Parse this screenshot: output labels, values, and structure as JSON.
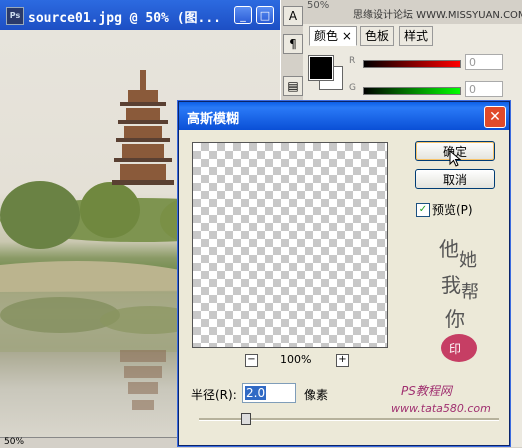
{
  "document": {
    "title": "source01.jpg @ 50% (图...",
    "app_icon": "Ps",
    "zoom_status": "50%",
    "buttons": [
      "_",
      "□"
    ]
  },
  "tools": {
    "items": [
      "A",
      "¶",
      "▤"
    ]
  },
  "color_panel": {
    "zoom_readout": "50%",
    "watermark": "思缘设计论坛 WWW.MISSYUAN.COM",
    "tabs": [
      "颜色",
      "色板",
      "样式"
    ],
    "tab_close": "×",
    "slider_labels": [
      "R",
      "G"
    ],
    "values": [
      "0",
      "0"
    ]
  },
  "dialog": {
    "title": "高斯模糊",
    "close": "✕",
    "ok_label": "确定",
    "cancel_label": "取消",
    "preview_label": "预览(P)",
    "preview_checked": true,
    "zoom_minus": "−",
    "zoom_plus": "+",
    "zoom_value": "100%",
    "radius_label": "半径(R):",
    "radius_value": "2.0",
    "radius_unit": "像素",
    "stamp_lines": [
      "他",
      "她",
      "我",
      "帮",
      "你"
    ],
    "brand": "PS教程网",
    "brand_url": "www.tata580.com"
  }
}
